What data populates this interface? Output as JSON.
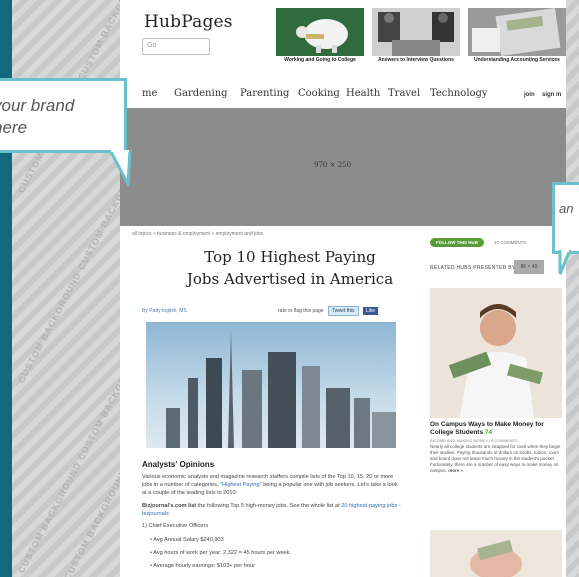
{
  "background": {
    "watermark": "CUSTOM BACKGROUND CUSTOM BACKGROUND CU",
    "colors": {
      "teal": "#11697d",
      "callout_border": "#68c1cd"
    }
  },
  "header": {
    "logo": "HubPages",
    "search_placeholder": "Go",
    "featured": [
      {
        "caption": "Working and Going to College"
      },
      {
        "caption": "Answers to Interview Questions"
      },
      {
        "caption": "Understanding Accounting Services"
      }
    ]
  },
  "nav": {
    "items": [
      "me",
      "Gardening",
      "Parenting",
      "Cooking",
      "Health",
      "Travel",
      "Technology"
    ],
    "join": "join",
    "signin": "sign in"
  },
  "ad": {
    "size_label": "970 × 250"
  },
  "callouts": {
    "left": {
      "line1": "your brand",
      "line2": "here"
    },
    "right": {
      "text": "an"
    }
  },
  "article": {
    "breadcrumb": "all topics » business & employment » employment and jobs",
    "title_line1": "Top 10 Highest Paying",
    "title_line2": "Jobs Advertised in America",
    "byline": "By Patty Inglish, MS",
    "rate_flag": "rate or flag this page",
    "tweet": "Tweet this",
    "like": "Like",
    "section_heading": "Analysts' Opinions",
    "para1_a": "Various economic analysts and magazine research staffers compile lists of the Top 10, 15, 20 or more jobs in a number of categories, \"",
    "para1_link": "Highest Paying",
    "para1_b": "\" being a popular one with job seekers. Let's take a look at a couple of the leading lists in 2010:",
    "para2_bold": "Bizjournal's.com list",
    "para2_text": " the following Top 5 high-money jobs. See the whole list at ",
    "para2_link": "20 highest-paying jobs - bizjournals",
    "list_heading": "1) Chief Executive Officers",
    "bullets": [
      "Avg Annual Salary $240,903",
      "Avg hours of work per year: 2,322 = 45 hours per week.",
      "Average hourly earnings: $103+ per hour"
    ]
  },
  "sidebar": {
    "follow": "FOLLOW THIS HUB",
    "comments": "37 COMMENTS",
    "related": "RELATED HUBS PRESENTED BY",
    "ad_size": "80 × 40",
    "hub_title": "On Campus Ways to Make Money for College Students",
    "hub_score": "74",
    "hub_meta": "INCOME AND MAKING MONEY | 8 COMMENTS",
    "hub_text": "Nearly all college students are strapped for cash when they begin their studies. Paying thousands of dollars on books, tuition, room and board does not leave much money in the student's pocket. Fortunately, there are a number of easy ways to make money on campus.",
    "more": "more »"
  }
}
